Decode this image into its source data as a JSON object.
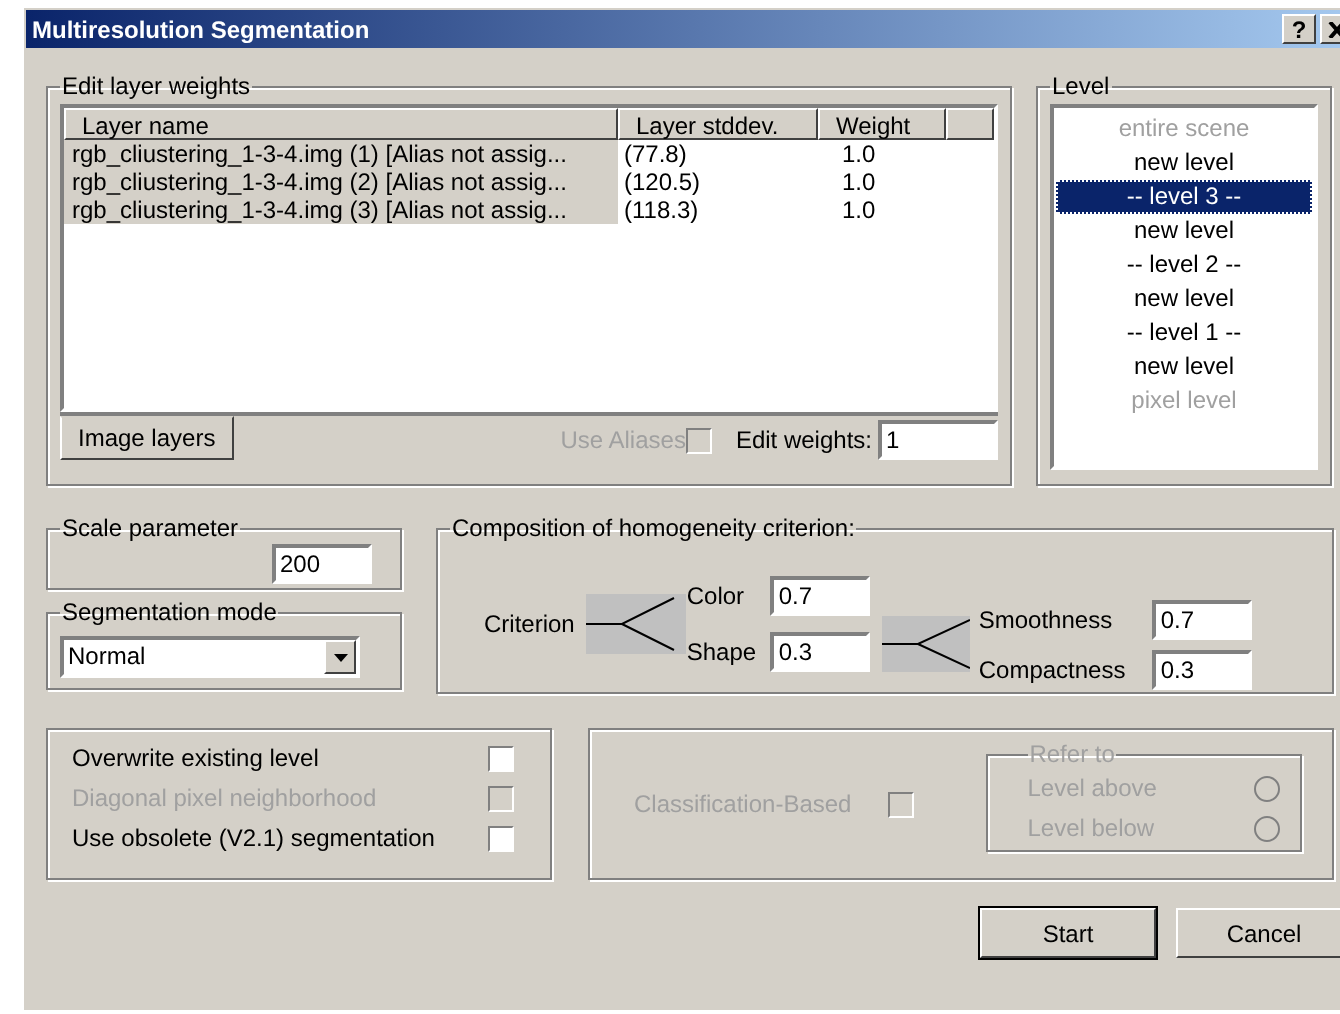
{
  "window": {
    "title": "Multiresolution Segmentation",
    "help_button": "?"
  },
  "layer_weights": {
    "title": "Edit layer weights",
    "columns": [
      "Layer name",
      "Layer stddev.",
      "Weight"
    ],
    "rows": [
      {
        "name": "rgb_cliustering_1-3-4.img (1) [Alias not assig...",
        "stddev": "(77.8)",
        "weight": "1.0"
      },
      {
        "name": "rgb_cliustering_1-3-4.img (2) [Alias not assig...",
        "stddev": "(120.5)",
        "weight": "1.0"
      },
      {
        "name": "rgb_cliustering_1-3-4.img (3) [Alias not assig...",
        "stddev": "(118.3)",
        "weight": "1.0"
      }
    ],
    "tab": {
      "label": "Image layers",
      "selected": true
    },
    "use_aliases": {
      "label": "Use Aliases",
      "checked": false,
      "disabled": true
    },
    "edit_weights": {
      "label": "Edit weights:",
      "value": "1"
    }
  },
  "level": {
    "title": "Level",
    "items": [
      {
        "label": "entire scene",
        "selected": false,
        "disabled": true
      },
      {
        "label": "new level",
        "selected": false,
        "disabled": false
      },
      {
        "label": "-- level 3 --",
        "selected": true,
        "disabled": false
      },
      {
        "label": "new level",
        "selected": false,
        "disabled": false
      },
      {
        "label": "-- level 2 --",
        "selected": false,
        "disabled": false
      },
      {
        "label": "new level",
        "selected": false,
        "disabled": false
      },
      {
        "label": "-- level 1 --",
        "selected": false,
        "disabled": false
      },
      {
        "label": "new level",
        "selected": false,
        "disabled": false
      },
      {
        "label": "pixel level",
        "selected": false,
        "disabled": true
      }
    ]
  },
  "scale_parameter": {
    "title": "Scale parameter",
    "value": "200"
  },
  "segmentation_mode": {
    "title": "Segmentation mode",
    "value": "Normal"
  },
  "composition": {
    "title": "Composition of homogeneity criterion:",
    "criterion": "Criterion",
    "color": {
      "label": "Color",
      "value": "0.7"
    },
    "shape": {
      "label": "Shape",
      "value": "0.3"
    },
    "smoothness": {
      "label": "Smoothness",
      "value": "0.7"
    },
    "compactness": {
      "label": "Compactness",
      "value": "0.3"
    }
  },
  "options": [
    {
      "label": "Overwrite existing level",
      "checked": false,
      "disabled": false
    },
    {
      "label": "Diagonal pixel neighborhood",
      "checked": false,
      "disabled": true
    },
    {
      "label": "Use obsolete (V2.1) segmentation",
      "checked": false,
      "disabled": false
    }
  ],
  "classification": {
    "label": "Classification-Based",
    "checked": false,
    "disabled": true,
    "refer_to": {
      "title": "Refer to",
      "disabled": true,
      "options": [
        {
          "label": "Level above",
          "selected": false
        },
        {
          "label": "Level below",
          "selected": false
        }
      ]
    }
  },
  "buttons": [
    {
      "label": "Start",
      "default": true
    },
    {
      "label": "Cancel",
      "default": false
    }
  ]
}
